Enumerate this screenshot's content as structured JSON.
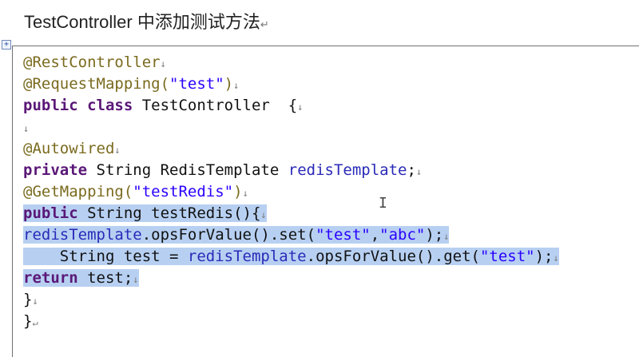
{
  "heading": {
    "title": "TestController 中添加测试方法",
    "end_mark": "↵"
  },
  "code": {
    "eol_mark": "↓",
    "last_mark": "↵",
    "lines": [
      [
        {
          "t": "@RestController",
          "c": "ann"
        }
      ],
      [
        {
          "t": "@RequestMapping(",
          "c": "ann"
        },
        {
          "t": "\"test\"",
          "c": "str"
        },
        {
          "t": ")",
          "c": "ann"
        }
      ],
      [
        {
          "t": "public class",
          "c": "kw"
        },
        {
          "t": " TestController  {",
          "c": "cls"
        }
      ],
      [],
      [
        {
          "t": "@Autowired",
          "c": "ann"
        }
      ],
      [
        {
          "t": "private",
          "c": "kw"
        },
        {
          "t": " String RedisTemplate ",
          "c": "cls"
        },
        {
          "t": "redisTemplate",
          "c": "fld"
        },
        {
          "t": ";",
          "c": "cls"
        }
      ],
      [
        {
          "t": "@GetMapping(",
          "c": "ann"
        },
        {
          "t": "\"testRedis\"",
          "c": "str"
        },
        {
          "t": ")",
          "c": "ann"
        }
      ],
      [
        {
          "t": "public",
          "c": "kw"
        },
        {
          "t": " String testRedis(){",
          "c": "cls"
        }
      ],
      [
        {
          "t": "redisTemplate",
          "c": "fld"
        },
        {
          "t": ".opsForValue().set(",
          "c": "cls"
        },
        {
          "t": "\"test\"",
          "c": "str"
        },
        {
          "t": ",",
          "c": "cls"
        },
        {
          "t": "\"abc\"",
          "c": "str"
        },
        {
          "t": ");",
          "c": "cls"
        }
      ],
      [
        {
          "t": "    String test = ",
          "c": "cls"
        },
        {
          "t": "redisTemplate",
          "c": "fld"
        },
        {
          "t": ".opsForValue().get(",
          "c": "cls"
        },
        {
          "t": "\"test\"",
          "c": "str"
        },
        {
          "t": ");",
          "c": "cls"
        }
      ],
      [
        {
          "t": "return",
          "c": "kw"
        },
        {
          "t": " test;",
          "c": "cls"
        }
      ],
      [
        {
          "t": "}",
          "c": "cls"
        }
      ],
      [
        {
          "t": "}",
          "c": "cls"
        }
      ]
    ]
  },
  "widgets": {
    "expand_glyph": "+",
    "text_cursor_glyph": "I"
  }
}
